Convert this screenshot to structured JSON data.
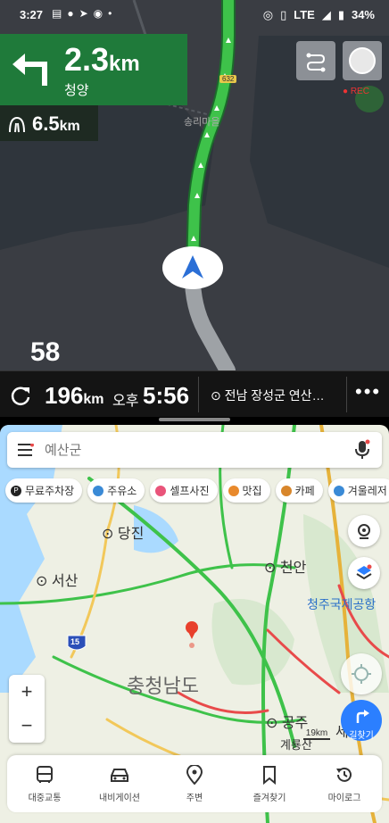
{
  "status": {
    "time": "3:27",
    "network": "LTE",
    "battery": "34%"
  },
  "nav": {
    "turn_distance": "2.3",
    "turn_unit": "km",
    "turn_street": "청양",
    "next_distance": "6.5",
    "next_unit": "km",
    "route_shield": "632",
    "map_place": "송리마을",
    "rec_label": "REC",
    "speed": "58"
  },
  "trip": {
    "remaining_distance": "196",
    "remaining_unit": "km",
    "ampm": "오후",
    "eta": "5:56",
    "destination": "전남 장성군 연산…"
  },
  "map": {
    "search_placeholder": "예산군",
    "chips": [
      {
        "label": "무료주차장",
        "icon": "parking-icon",
        "color": "#222"
      },
      {
        "label": "주유소",
        "icon": "gas-station-icon",
        "color": "#3a8ad6"
      },
      {
        "label": "셀프사진",
        "icon": "camera-icon",
        "color": "#e9547a"
      },
      {
        "label": "맛집",
        "icon": "restaurant-icon",
        "color": "#e8892c"
      },
      {
        "label": "카페",
        "icon": "cafe-icon",
        "color": "#d8862b"
      },
      {
        "label": "겨울레저",
        "icon": "ski-icon",
        "color": "#3a8ad6"
      }
    ],
    "places": {
      "dangjin": "당진",
      "seosan": "서산",
      "cheonan": "천안",
      "airport": "청주국제공항",
      "region": "충청남도",
      "gongju": "공주",
      "sejong": "세종",
      "gyeryongsan": "계룡산",
      "highway": "15"
    },
    "scale": "19km",
    "zoom_in": "+",
    "zoom_out": "−",
    "direction_label": "길찾기",
    "bottom_nav": [
      {
        "label": "대중교통",
        "icon": "bus-icon"
      },
      {
        "label": "내비게이션",
        "icon": "car-icon"
      },
      {
        "label": "주변",
        "icon": "location-pin-icon"
      },
      {
        "label": "즐겨찾기",
        "icon": "bookmark-icon"
      },
      {
        "label": "마이로그",
        "icon": "history-icon"
      }
    ]
  },
  "colors": {
    "turn_green": "#1f7a3a",
    "route_green": "#3ec24a",
    "accent_blue": "#2b7fff"
  }
}
